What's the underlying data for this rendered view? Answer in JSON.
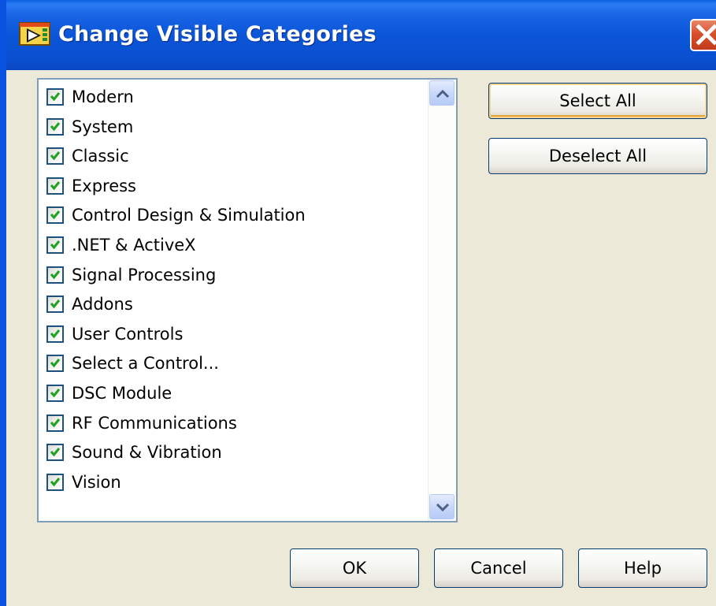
{
  "window": {
    "title": "Change Visible Categories",
    "icon": "labview-app-icon",
    "close_icon": "close-icon"
  },
  "categories": {
    "items": [
      {
        "label": "Modern",
        "checked": true
      },
      {
        "label": "System",
        "checked": true
      },
      {
        "label": "Classic",
        "checked": true
      },
      {
        "label": "Express",
        "checked": true
      },
      {
        "label": "Control Design & Simulation",
        "checked": true
      },
      {
        "label": ".NET & ActiveX",
        "checked": true
      },
      {
        "label": "Signal Processing",
        "checked": true
      },
      {
        "label": "Addons",
        "checked": true
      },
      {
        "label": "User Controls",
        "checked": true
      },
      {
        "label": "Select a Control...",
        "checked": true
      },
      {
        "label": "DSC Module",
        "checked": true
      },
      {
        "label": "RF Communications",
        "checked": true
      },
      {
        "label": "Sound & Vibration",
        "checked": true
      },
      {
        "label": "Vision",
        "checked": true
      }
    ]
  },
  "actions": {
    "select_all": "Select All",
    "deselect_all": "Deselect All"
  },
  "footer": {
    "ok": "OK",
    "cancel": "Cancel",
    "help": "Help"
  },
  "colors": {
    "titlebar": "#0a4fd0",
    "checkmark": "#21a121",
    "close_button": "#d8502c"
  }
}
